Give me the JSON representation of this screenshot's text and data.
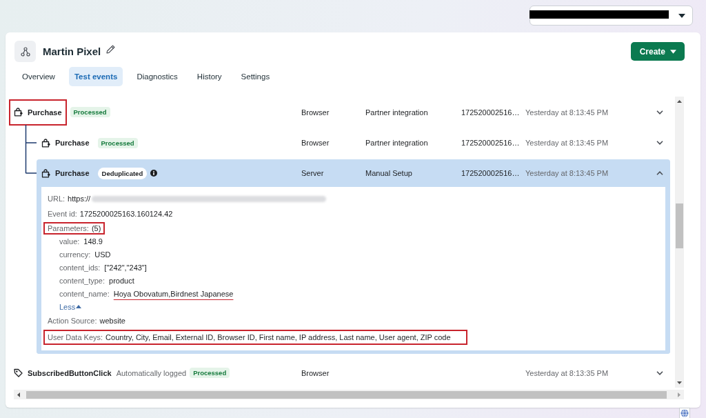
{
  "account_switcher": {
    "redacted": true
  },
  "pixel": {
    "name": "Martin Pixel"
  },
  "create_button": {
    "label": "Create"
  },
  "tabs": [
    {
      "label": "Overview",
      "selected": false
    },
    {
      "label": "Test events",
      "selected": true
    },
    {
      "label": "Diagnostics",
      "selected": false
    },
    {
      "label": "History",
      "selected": false
    },
    {
      "label": "Settings",
      "selected": false
    }
  ],
  "events": [
    {
      "kind": "purchase",
      "name": "Purchase",
      "highlighted": true,
      "status": {
        "kind": "processed",
        "label": "Processed",
        "info": false
      },
      "source": "Browser",
      "integration": "Partner integration",
      "event_id": "172520002516…",
      "time": "Yesterday at 8:13:45 PM",
      "expanded": false,
      "children": [
        {
          "kind": "purchase",
          "name": "Purchase",
          "highlighted": false,
          "status": {
            "kind": "processed",
            "label": "Processed",
            "info": false
          },
          "source": "Browser",
          "integration": "Partner integration",
          "event_id": "172520002516…",
          "time": "Yesterday at 8:13:45 PM",
          "expanded": false
        },
        {
          "kind": "purchase",
          "name": "Purchase",
          "highlighted": false,
          "status": {
            "kind": "deduplicated",
            "label": "Deduplicated",
            "info": true
          },
          "source": "Server",
          "integration": "Manual Setup",
          "event_id": "172520002516…",
          "time": "Yesterday at 8:13:45 PM",
          "expanded": true,
          "details": {
            "url": {
              "label": "URL:",
              "value": "https://",
              "blurred": true
            },
            "event_id": {
              "label": "Event id:",
              "value": "1725200025163.160124.42"
            },
            "parameters": {
              "label": "Parameters:",
              "count": "(5)",
              "highlighted": true,
              "expanded": true,
              "toggle": "Less",
              "items": [
                {
                  "key": "value:",
                  "value": "148.9",
                  "underlined": false
                },
                {
                  "key": "currency:",
                  "value": "USD",
                  "underlined": false
                },
                {
                  "key": "content_ids:",
                  "value": "[\"242\",\"243\"]",
                  "underlined": false
                },
                {
                  "key": "content_type:",
                  "value": "product",
                  "underlined": false
                },
                {
                  "key": "content_name:",
                  "value": "Hoya Obovatum,Birdnest Japanese",
                  "underlined": true
                }
              ]
            },
            "action_source": {
              "label": "Action Source:",
              "value": "website"
            },
            "user_data_keys": {
              "label": "User Data Keys:",
              "value": "Country, City, Email, External ID, Browser ID, First name, IP address, Last name, User agent, ZIP code",
              "highlighted": true
            }
          }
        }
      ]
    },
    {
      "kind": "click",
      "name": "SubscribedButtonClick",
      "note": "Automatically logged",
      "highlighted": false,
      "status": {
        "kind": "processed",
        "label": "Processed",
        "info": false
      },
      "source": "Browser",
      "time": "Yesterday at 8:13:35 PM",
      "expanded": false
    }
  ]
}
